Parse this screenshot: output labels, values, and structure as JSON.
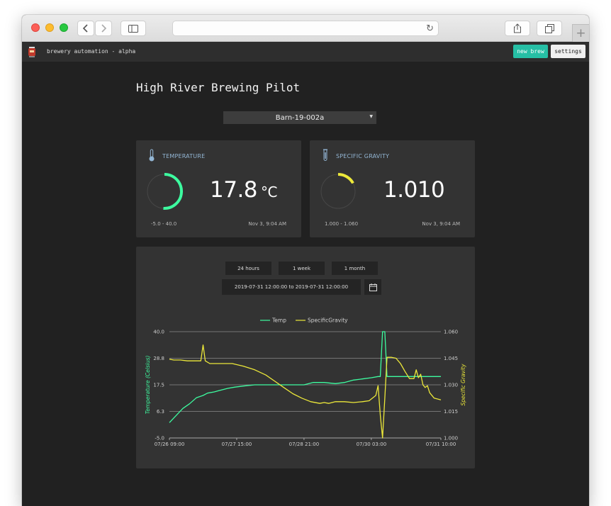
{
  "app": {
    "title": "brewery automation - alpha",
    "new_brew_label": "new brew",
    "settings_label": "settings"
  },
  "page": {
    "title": "High River Brewing Pilot",
    "selected_brew": "Barn-19-002a"
  },
  "temperature": {
    "label": "TEMPERATURE",
    "value": "17.8",
    "unit": "°C",
    "range": "-5.0 - 40.0",
    "timestamp": "Nov 3, 9:04 AM",
    "gauge_fraction": 0.51,
    "color": "#3dfca0"
  },
  "gravity": {
    "label": "SPECIFIC GRAVITY",
    "value": "1.010",
    "range": "1.000 - 1.060",
    "timestamp": "Nov 3, 9:04 AM",
    "gauge_fraction": 0.17,
    "color": "#ece83a"
  },
  "history": {
    "ranges": [
      "24 hours",
      "1 week",
      "1 month"
    ],
    "daterange": "2019-07-31 12:00:00 to 2019-07-31 12:00:00"
  },
  "chart_data": {
    "type": "line",
    "x_tick_labels": [
      "07/26 09:00",
      "07/27 15:00",
      "07/28 21:00",
      "07/30 03:00",
      "07/31 10:00"
    ],
    "x_hours": [
      0,
      30,
      60,
      90,
      121
    ],
    "xlim": [
      0,
      121
    ],
    "y_left_label": "Temperature (Celsius)",
    "y_left_ticks": [
      "40.0",
      "28.8",
      "17.5",
      "6.3",
      "-5.0"
    ],
    "y_left_lim": [
      -5.0,
      40.0
    ],
    "y_right_label": "Specific Gravity",
    "y_right_ticks": [
      "1.060",
      "1.045",
      "1.030",
      "1.015",
      "1.000"
    ],
    "y_right_lim": [
      1.0,
      1.06
    ],
    "legend_position": "top-center",
    "grid": true,
    "series": [
      {
        "name": "Temp",
        "color": "#3dfca0",
        "axis": "left",
        "points": [
          [
            0,
            1.5
          ],
          [
            3,
            4.5
          ],
          [
            6,
            7.5
          ],
          [
            9,
            9.5
          ],
          [
            12,
            12.0
          ],
          [
            15,
            13.0
          ],
          [
            17,
            14.0
          ],
          [
            20,
            14.5
          ],
          [
            22,
            15.0
          ],
          [
            26,
            16.0
          ],
          [
            29,
            16.5
          ],
          [
            33,
            17.0
          ],
          [
            38,
            17.5
          ],
          [
            43,
            17.5
          ],
          [
            48,
            17.5
          ],
          [
            54,
            17.5
          ],
          [
            60,
            17.5
          ],
          [
            64,
            18.5
          ],
          [
            69,
            18.5
          ],
          [
            74,
            18.0
          ],
          [
            78,
            18.5
          ],
          [
            82,
            19.5
          ],
          [
            86,
            20.0
          ],
          [
            90,
            20.5
          ],
          [
            93,
            21.0
          ],
          [
            94,
            21.0
          ],
          [
            95,
            40.0
          ],
          [
            96,
            40.0
          ],
          [
            97,
            21.0
          ],
          [
            101,
            21.0
          ],
          [
            106,
            21.0
          ],
          [
            111,
            21.0
          ],
          [
            116,
            21.0
          ],
          [
            121,
            21.0
          ]
        ]
      },
      {
        "name": "SpecificGravity",
        "color": "#ece83a",
        "axis": "right",
        "points": [
          [
            0,
            1.0445
          ],
          [
            2,
            1.044
          ],
          [
            5,
            1.044
          ],
          [
            8,
            1.0435
          ],
          [
            11,
            1.0435
          ],
          [
            14,
            1.0435
          ],
          [
            15,
            1.0525
          ],
          [
            16,
            1.0435
          ],
          [
            18,
            1.042
          ],
          [
            22,
            1.042
          ],
          [
            28,
            1.042
          ],
          [
            33,
            1.0405
          ],
          [
            38,
            1.0385
          ],
          [
            43,
            1.0355
          ],
          [
            47,
            1.032
          ],
          [
            51,
            1.0285
          ],
          [
            55,
            1.025
          ],
          [
            59,
            1.0225
          ],
          [
            63,
            1.0205
          ],
          [
            67,
            1.0195
          ],
          [
            69,
            1.02
          ],
          [
            71,
            1.0195
          ],
          [
            74,
            1.0205
          ],
          [
            78,
            1.0205
          ],
          [
            82,
            1.02
          ],
          [
            86,
            1.0205
          ],
          [
            89,
            1.021
          ],
          [
            92,
            1.024
          ],
          [
            93,
            1.0295
          ],
          [
            94,
            1.013
          ],
          [
            95,
            1.0
          ],
          [
            96,
            1.0225
          ],
          [
            97,
            1.0455
          ],
          [
            99,
            1.0455
          ],
          [
            101,
            1.045
          ],
          [
            103,
            1.042
          ],
          [
            105,
            1.0375
          ],
          [
            107,
            1.0335
          ],
          [
            109,
            1.0335
          ],
          [
            110,
            1.0385
          ],
          [
            111,
            1.034
          ],
          [
            112,
            1.036
          ],
          [
            113,
            1.03
          ],
          [
            114,
            1.0285
          ],
          [
            115,
            1.0295
          ],
          [
            116,
            1.0255
          ],
          [
            118,
            1.0225
          ],
          [
            121,
            1.0215
          ]
        ]
      }
    ]
  }
}
